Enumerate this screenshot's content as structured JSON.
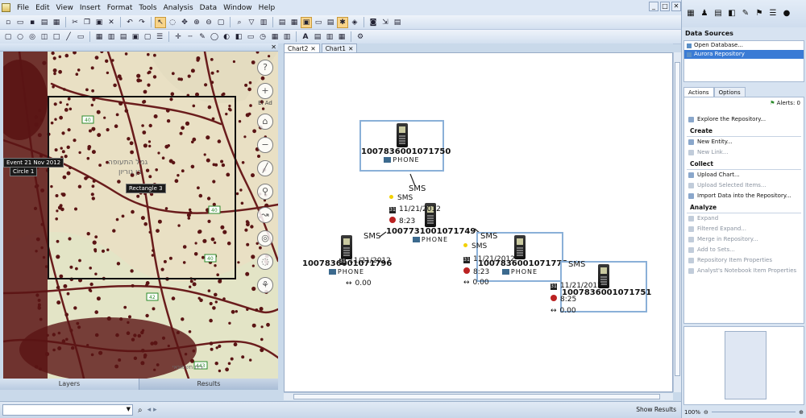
{
  "menu": {
    "items": [
      "File",
      "Edit",
      "View",
      "Insert",
      "Format",
      "Tools",
      "Analysis",
      "Data",
      "Window",
      "Help"
    ]
  },
  "window_controls": [
    "_",
    "□",
    "✕"
  ],
  "map": {
    "zoom_label": "El Ad",
    "tags": [
      "Event 21 Nov 2012",
      "Circle 1",
      "Rectangle 3"
    ],
    "labels_hebrew": [
      "גמל התעופה",
      "בן גוריון",
      "בית חשמונאי"
    ],
    "road_numbers": [
      "40",
      "40",
      "40",
      "42",
      "443"
    ],
    "colors": {
      "dot": "#5a1414",
      "roads": "#6a1c1c",
      "rect": "#111111"
    }
  },
  "bottom_tabs": {
    "layers": "Layers",
    "results": "Results"
  },
  "chart_tabs": [
    {
      "label": "Chart2",
      "close": "✕",
      "active": true
    },
    {
      "label": "Chart1",
      "close": "✕",
      "active": false
    }
  ],
  "entities": [
    {
      "id": "1007836001071750",
      "type": "PHONE",
      "boxed": true
    },
    {
      "id": "1007731001071749",
      "type": "PHONE",
      "boxed": false
    },
    {
      "id": "1007836001071796",
      "type": "PHONE",
      "boxed": false
    },
    {
      "id": "1007836001071778",
      "type": "PHONE",
      "boxed": true
    },
    {
      "id": "1007836001071751",
      "type": "PHONE",
      "boxed": true
    }
  ],
  "links": [
    {
      "label": "SMS",
      "sub": "SMS",
      "date": "11/21/2012",
      "time": "8:23",
      "value": ""
    },
    {
      "label": "SMS",
      "sub": "",
      "date": "11/21/2012",
      "time": "",
      "value": "0.00"
    },
    {
      "label": "SMS",
      "sub": "SMS",
      "date": "11/21/2012",
      "time": "8:23",
      "value": "0.00"
    },
    {
      "label": "SMS",
      "sub": "",
      "date": "11/21/2012",
      "time": "8:25",
      "value": "0.00"
    }
  ],
  "right_panel": {
    "data_sources_title": "Data Sources",
    "data_sources": [
      "Open Database...",
      "Aurora Repository"
    ],
    "tabs": [
      "Actions",
      "Options"
    ],
    "alerts": "Alerts: 0",
    "explore": "Explore the Repository...",
    "sections": [
      {
        "title": "Create",
        "items": [
          {
            "label": "New Entity...",
            "enabled": true
          },
          {
            "label": "New Link...",
            "enabled": false
          }
        ]
      },
      {
        "title": "Collect",
        "items": [
          {
            "label": "Upload Chart...",
            "enabled": true
          },
          {
            "label": "Upload Selected Items...",
            "enabled": false
          },
          {
            "label": "Import Data into the Repository...",
            "enabled": true
          }
        ]
      },
      {
        "title": "Analyze",
        "items": [
          {
            "label": "Expand",
            "enabled": false
          },
          {
            "label": "Filtered Expand...",
            "enabled": false
          },
          {
            "label": "Merge in Repository...",
            "enabled": false
          },
          {
            "label": "Add to Sets...",
            "enabled": false
          },
          {
            "label": "Repository Item Properties",
            "enabled": false
          },
          {
            "label": "Analyst's Notebook Item Properties",
            "enabled": false
          }
        ]
      }
    ],
    "zoom": "100%"
  },
  "status": {
    "search_value": "",
    "show_results": "Show Results"
  }
}
